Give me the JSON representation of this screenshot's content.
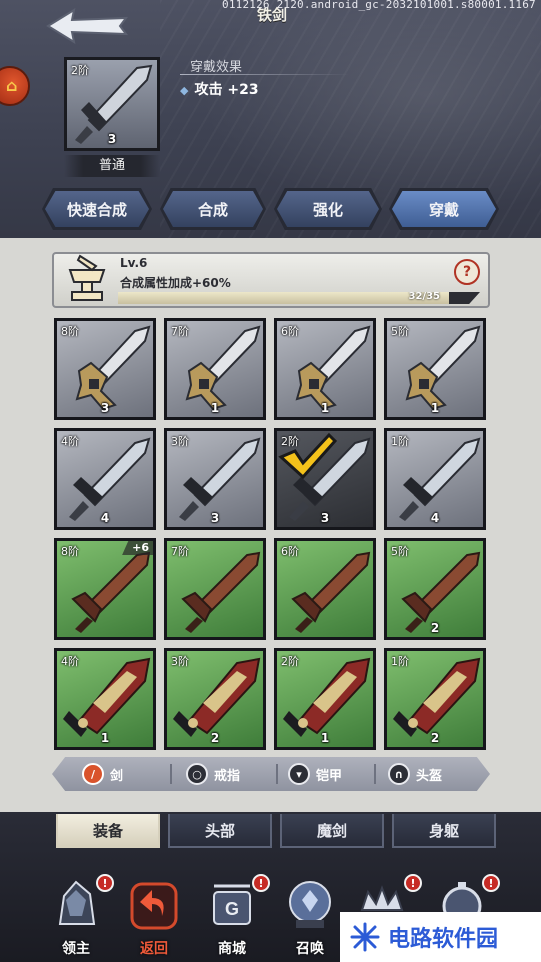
{
  "header": {
    "build_info": "0112126 2120.android_gc-2032101001.s80001.1167",
    "title": "铁剑"
  },
  "equipped": {
    "tier": "2阶",
    "count": "3",
    "rarity": "普通",
    "effect_heading": "穿戴效果",
    "effect_value": "攻击 +23"
  },
  "actions": [
    {
      "label": "快速合成"
    },
    {
      "label": "合成"
    },
    {
      "label": "强化"
    },
    {
      "label": "穿戴"
    }
  ],
  "synthesis": {
    "level": "Lv.6",
    "bonus": "合成属性加成+60%",
    "progress_label": "32/35",
    "progress_current": 32,
    "progress_max": 35,
    "help": "?"
  },
  "grid": [
    {
      "tier": "8阶",
      "count": "3",
      "kind": "gray-sword"
    },
    {
      "tier": "7阶",
      "count": "1",
      "kind": "gray-sword"
    },
    {
      "tier": "6阶",
      "count": "1",
      "kind": "gray-sword"
    },
    {
      "tier": "5阶",
      "count": "1",
      "kind": "gray-sword"
    },
    {
      "tier": "4阶",
      "count": "4",
      "kind": "iron-sword"
    },
    {
      "tier": "3阶",
      "count": "3",
      "kind": "iron-sword"
    },
    {
      "tier": "2阶",
      "count": "3",
      "kind": "iron-sword-selected"
    },
    {
      "tier": "1阶",
      "count": "4",
      "kind": "iron-sword"
    },
    {
      "tier": "8阶",
      "count": "",
      "plus": "+6",
      "kind": "green-sword"
    },
    {
      "tier": "7阶",
      "count": "",
      "kind": "green-sword"
    },
    {
      "tier": "6阶",
      "count": "",
      "kind": "green-sword"
    },
    {
      "tier": "5阶",
      "count": "2",
      "kind": "green-sword"
    },
    {
      "tier": "4阶",
      "count": "1",
      "kind": "green-blade"
    },
    {
      "tier": "3阶",
      "count": "2",
      "kind": "green-blade"
    },
    {
      "tier": "2阶",
      "count": "1",
      "kind": "green-blade"
    },
    {
      "tier": "1阶",
      "count": "2",
      "kind": "green-blade"
    }
  ],
  "categories": [
    {
      "label": "剑",
      "icon": "sword-icon"
    },
    {
      "label": "戒指",
      "icon": "ring-icon"
    },
    {
      "label": "铠甲",
      "icon": "armor-icon"
    },
    {
      "label": "头盔",
      "icon": "helmet-icon"
    }
  ],
  "tabs": [
    {
      "label": "装备"
    },
    {
      "label": "头部"
    },
    {
      "label": "魔剑"
    },
    {
      "label": "身躯"
    }
  ],
  "nav": [
    {
      "label": "领主",
      "alert": "!"
    },
    {
      "label": "返回",
      "alert": ""
    },
    {
      "label": "商城",
      "alert": "!"
    },
    {
      "label": "召唤",
      "alert": ""
    },
    {
      "label": "",
      "alert": "!"
    },
    {
      "label": "",
      "alert": "!"
    }
  ],
  "watermark": "电路软件园",
  "colors": {
    "accent_green": "#3f7d3a",
    "active_red": "#f05a3a",
    "button_blue": "#3f5e94"
  }
}
